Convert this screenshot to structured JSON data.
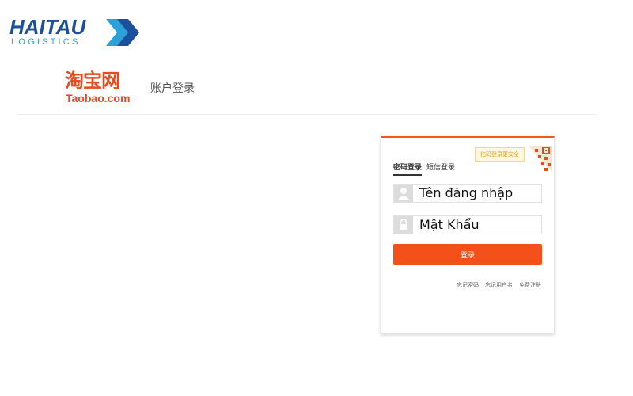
{
  "watermark": {
    "brand": "HAITAU",
    "sub": "LOGISTICS"
  },
  "header": {
    "logo_cn": "淘宝网",
    "logo_en": "Taobao.com",
    "title": "账户登录"
  },
  "login": {
    "qr_tip": "扫码登录更安全",
    "tabs": [
      {
        "label": "密码登录",
        "active": true
      },
      {
        "label": "短信登录",
        "active": false
      }
    ],
    "username_value": "Tên đăng nhập",
    "password_value": "Mật Khẩu",
    "submit_label": "登录",
    "links": [
      "忘记密码",
      "忘记用户名",
      "免费注册"
    ]
  },
  "colors": {
    "accent": "#f4501a",
    "brand_blue": "#1c4f9c",
    "brand_cyan": "#2ca0d8"
  }
}
